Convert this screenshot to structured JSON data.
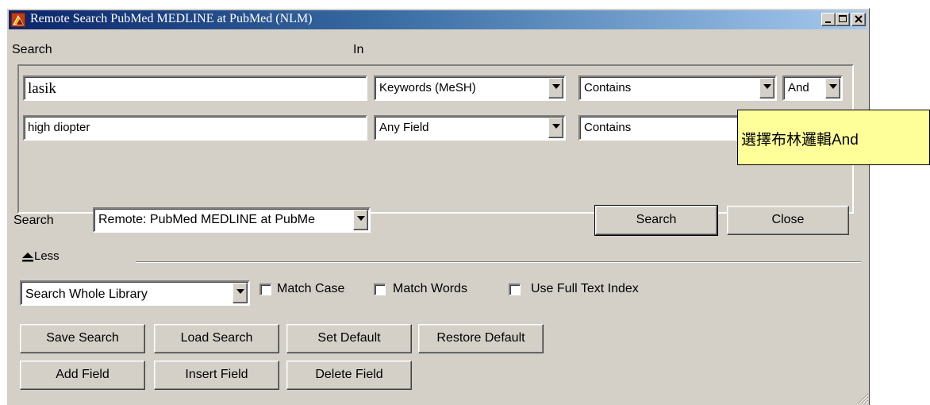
{
  "window": {
    "title": "Remote Search PubMed MEDLINE at PubMed (NLM)",
    "controls": {
      "minimize": "_",
      "maximize": "□",
      "close": "×"
    }
  },
  "headers": {
    "search": "Search",
    "in": "In"
  },
  "rows": [
    {
      "term": "lasik",
      "field": "Keywords (MeSH)",
      "operator": "Contains",
      "bool": "And"
    },
    {
      "term": "high diopter",
      "field": "Any Field",
      "operator": "Contains"
    }
  ],
  "source": {
    "label": "Search",
    "value": "Remote: PubMed MEDLINE at PubMe"
  },
  "actions": {
    "search": "Search",
    "close": "Close"
  },
  "less": {
    "label": "Less"
  },
  "scope": {
    "value": "Search Whole Library",
    "match_case": "Match Case",
    "match_words": "Match Words",
    "full_text": "Use Full Text Index"
  },
  "buttons": {
    "save": "Save Search",
    "load": "Load Search",
    "set_default": "Set Default",
    "restore_default": "Restore Default",
    "add_field": "Add Field",
    "insert_field": "Insert Field",
    "delete_field": "Delete Field"
  },
  "annotation": {
    "text": "選擇布林邏輯And"
  },
  "colors": {
    "titlebar_start": "#0a246a",
    "titlebar_end": "#a6caf0",
    "face": "#d4d0c8",
    "tooltip": "#ffff99"
  }
}
